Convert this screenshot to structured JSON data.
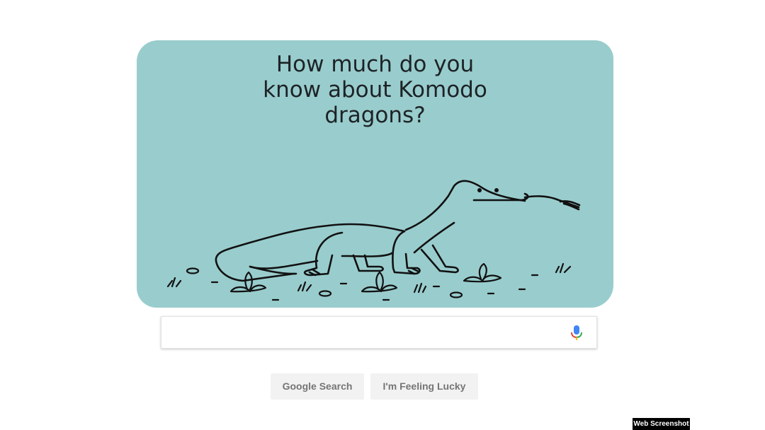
{
  "doodle": {
    "title_lines": [
      "How much do you",
      "know about Komodo",
      "dragons?"
    ],
    "background_color": "#99cccd",
    "illustration": "komodo-dragon"
  },
  "search": {
    "value": "",
    "placeholder": "",
    "voice_icon": "microphone-icon"
  },
  "buttons": {
    "search_label": "Google Search",
    "lucky_label": "I'm Feeling Lucky"
  },
  "watermark": {
    "label": "Web Screenshot"
  },
  "colors": {
    "mic_blue": "#4285f4",
    "mic_red": "#ea4335",
    "mic_yellow": "#fbbc05",
    "mic_green": "#34a853"
  }
}
